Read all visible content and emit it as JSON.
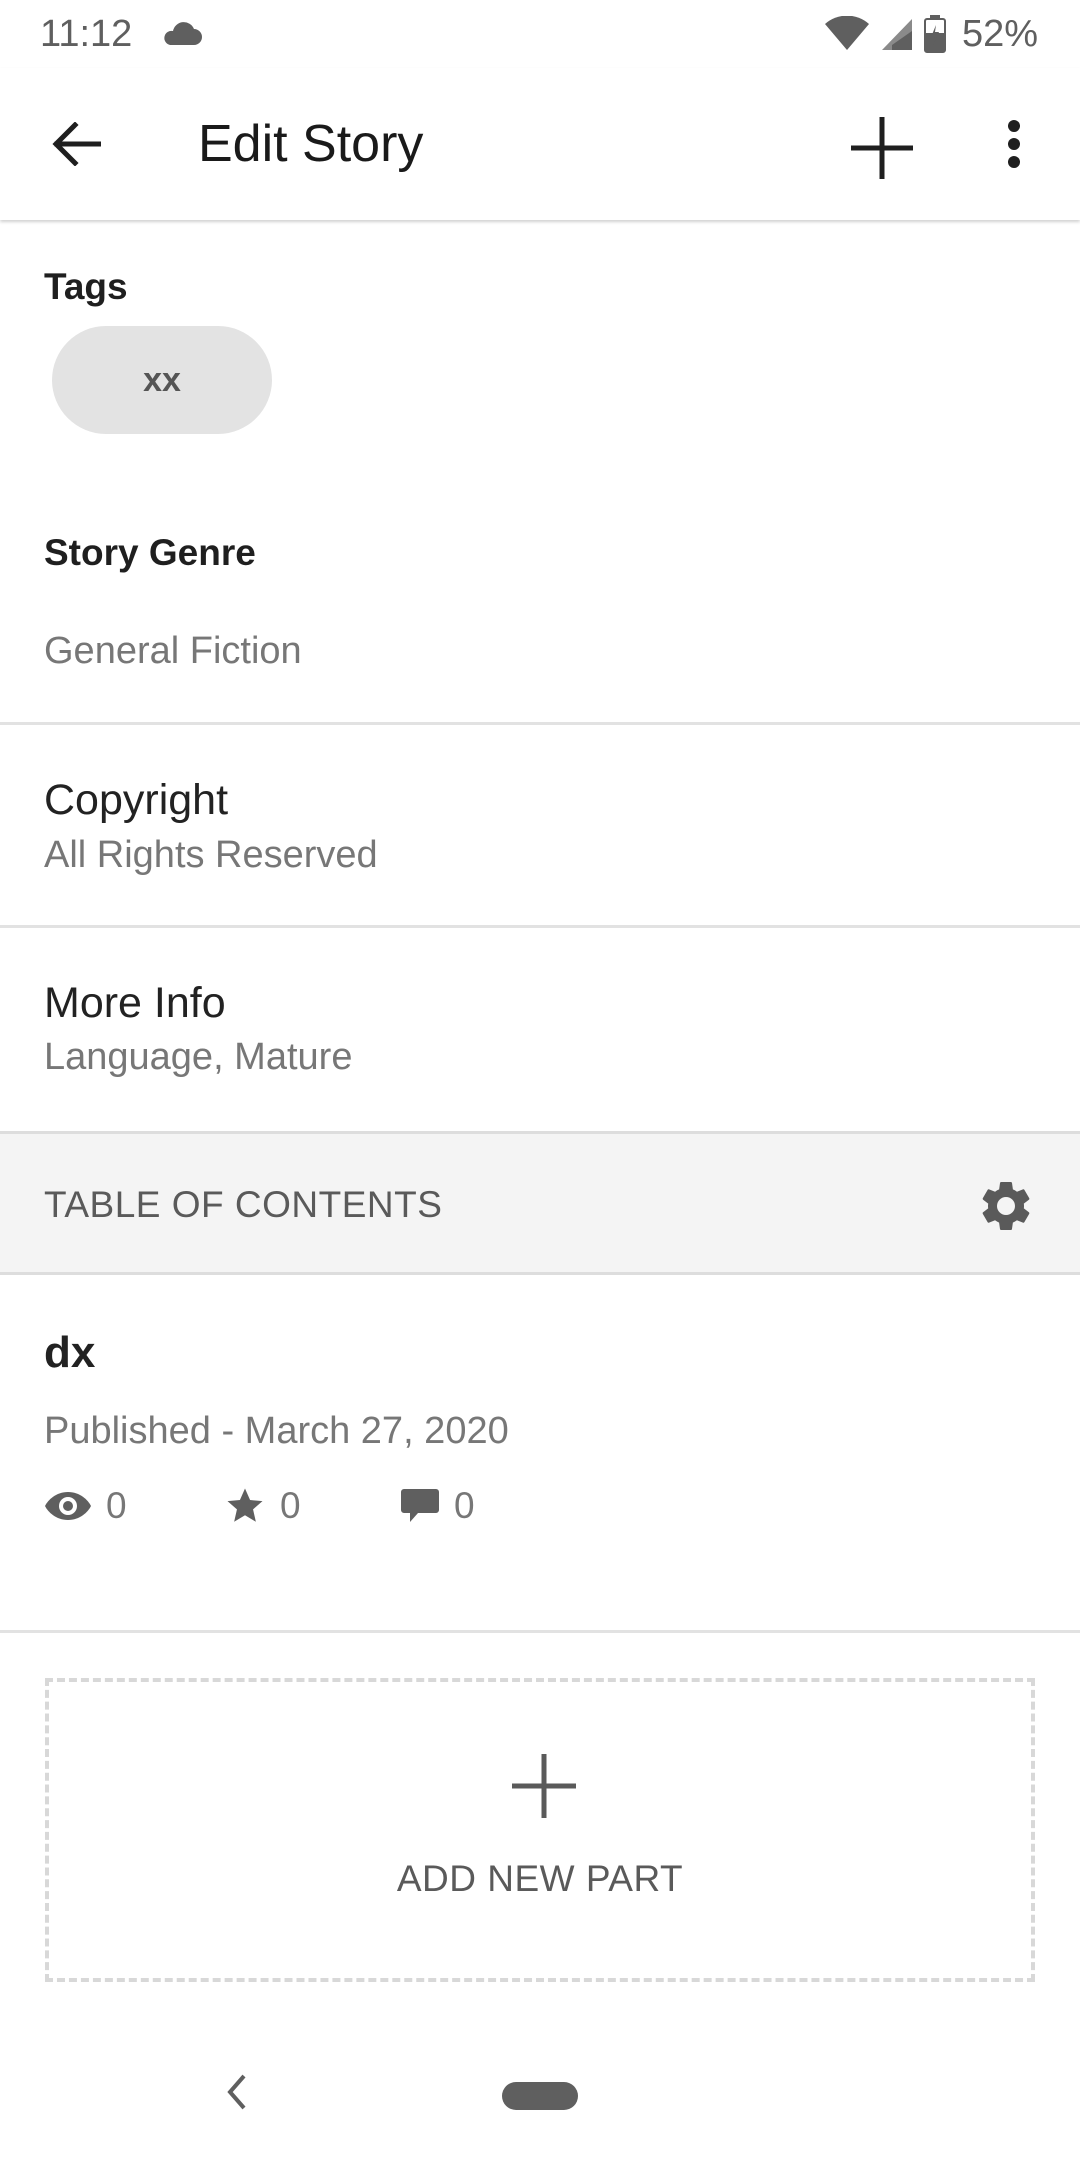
{
  "status_bar": {
    "time": "11:12",
    "battery": "52%",
    "icons": [
      "cloud-icon",
      "wifi-icon",
      "cell-signal-icon",
      "battery-icon"
    ]
  },
  "app_bar": {
    "title": "Edit Story",
    "icons": [
      "back-arrow-icon",
      "plus-icon",
      "more-vert-icon"
    ]
  },
  "tags": {
    "label": "Tags",
    "items": [
      "xx"
    ]
  },
  "genre": {
    "label": "Story Genre",
    "value": "General Fiction"
  },
  "copyright": {
    "title": "Copyright",
    "value": "All Rights Reserved"
  },
  "more_info": {
    "title": "More Info",
    "value": "Language, Mature"
  },
  "toc": {
    "title": "TABLE OF CONTENTS",
    "parts": [
      {
        "title": "dx",
        "status": "Published - March 27, 2020",
        "views": "0",
        "votes": "0",
        "comments": "0"
      }
    ]
  },
  "add_part": {
    "label": "ADD NEW PART"
  },
  "colors": {
    "divider": "#e2e2e2",
    "toc_background": "#f4f4f4",
    "secondary_text": "#777777",
    "chip_background": "#e3e3e3"
  }
}
